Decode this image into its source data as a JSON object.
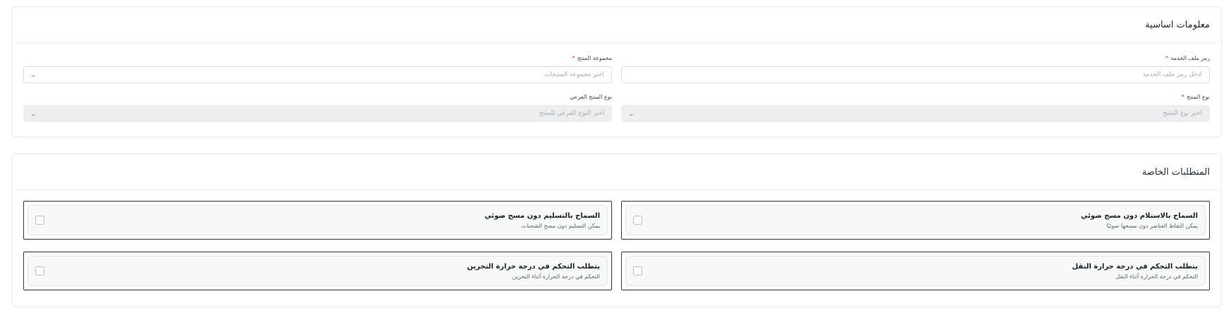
{
  "basic_info": {
    "title": "معلومات اساسية",
    "fields": {
      "service_file_code": {
        "label": "رمز ملف الخدمة",
        "required_mark": "*",
        "placeholder": "أدخل رمز ملف الخدمة",
        "value": ""
      },
      "product_group": {
        "label": "مجموعة المنتج",
        "required_mark": "*",
        "placeholder": "اختر مجموعة المنتجات"
      },
      "product_type": {
        "label": "نوع المنتج",
        "required_mark": "*",
        "placeholder": "اختر نوع المنتج"
      },
      "product_subtype": {
        "label": "نوع المنتج الفرعي",
        "placeholder": "اختر النوع الفرعي للمنتج"
      }
    },
    "chevron_icon": "chevron-down-icon"
  },
  "special_requirements": {
    "title": "المتطلبات الخاصة",
    "items": [
      {
        "title": "السماح بالاستلام دون مسح ضوئي",
        "description": "يمكن التقاط العناصر دون مسحها ضوئيًا",
        "checked": false
      },
      {
        "title": "السماح بالتسليم دون مسح ضوئي",
        "description": "يمكن التسليم دون مسح الشحنات",
        "checked": false
      },
      {
        "title": "يتطلب التحكم في درجة حرارة النقل",
        "description": "التحكم في درجة الحرارة أثناء النقل",
        "checked": false
      },
      {
        "title": "يتطلب التحكم في درجة حرارة التخزين",
        "description": "التحكم في درجة الحرارة أثناء التخزين",
        "checked": false
      }
    ]
  },
  "colors": {
    "required": "#e03131",
    "item_border": "#2f3b45",
    "disabled_bg": "#eceeef"
  }
}
